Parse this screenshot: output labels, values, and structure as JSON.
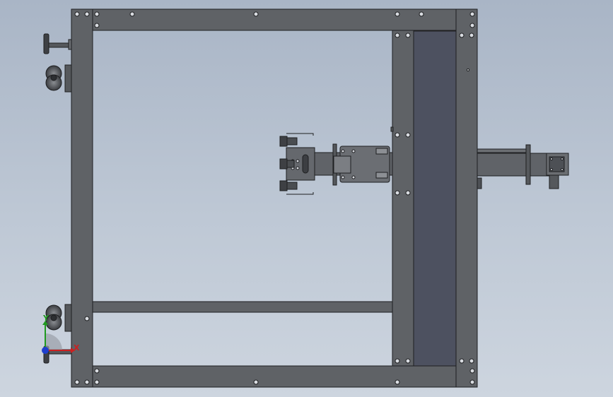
{
  "viewport": {
    "background_top": "#a9b5c6",
    "background_bottom": "#cdd5df"
  },
  "colors": {
    "frame_fill": "#5f6266",
    "frame_edge": "#1e1f21",
    "conveyor_belt": "#4d5160",
    "hole": "#d8dbe0"
  },
  "triad": {
    "x_label": "X",
    "y_label": "Y",
    "x_color": "#cc2020",
    "y_color": "#1f9a1f",
    "z_color": "#1f3fcc"
  }
}
